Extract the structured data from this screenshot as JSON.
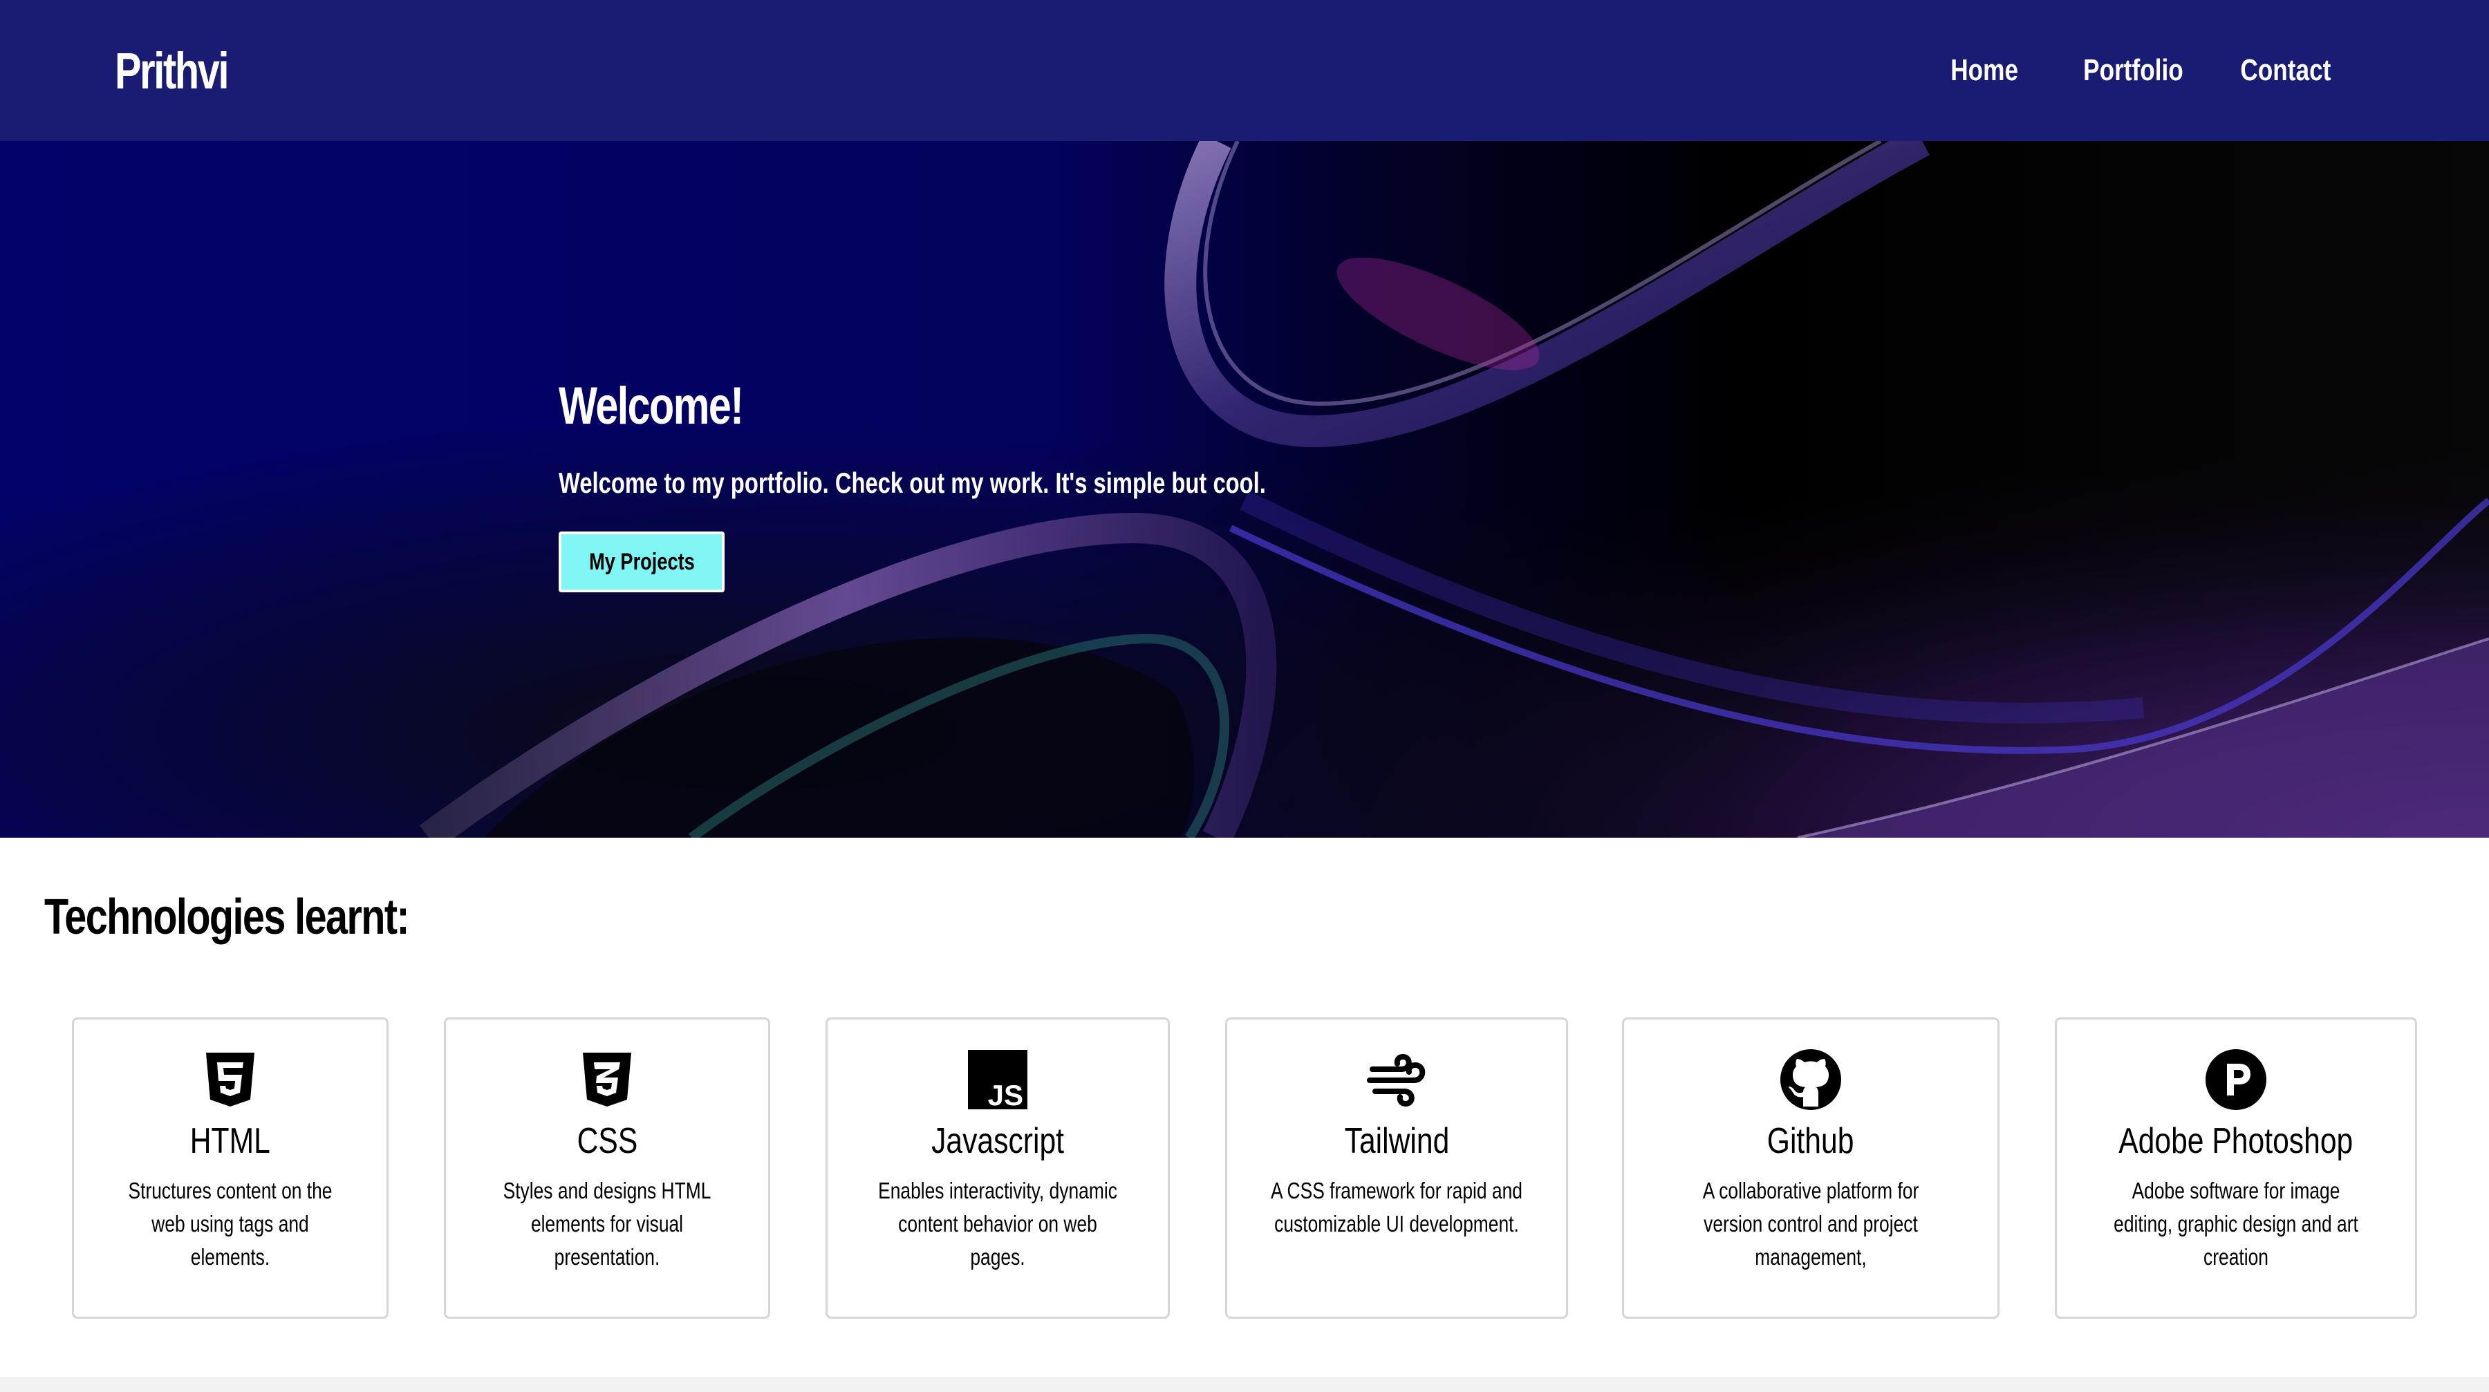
{
  "nav": {
    "brand": "Prithvi",
    "links": [
      "Home",
      "Portfolio",
      "Contact"
    ]
  },
  "hero": {
    "title": "Welcome!",
    "subtitle": "Welcome to my portfolio. Check out my work. It's simple but cool.",
    "button_label": "My Projects"
  },
  "tech": {
    "heading": "Technologies learnt:",
    "cards": [
      {
        "title": "HTML",
        "icon": "html5-icon",
        "desc": "Structures content on the web using tags and elements."
      },
      {
        "title": "CSS",
        "icon": "css3-icon",
        "desc": "Styles and designs HTML elements for visual presentation."
      },
      {
        "title": "Javascript",
        "icon": "javascript-icon",
        "desc": "Enables interactivity, dynamic content behavior on web pages."
      },
      {
        "title": "Tailwind",
        "icon": "wind-icon",
        "desc": "A CSS framework for rapid and customizable UI development."
      },
      {
        "title": "Github",
        "icon": "github-icon",
        "desc": "A collaborative platform for version control and project management,"
      },
      {
        "title": "Adobe Photoshop",
        "icon": "photoshop-p-icon",
        "desc": "Adobe software for image editing, graphic design and art creation"
      }
    ]
  },
  "colors": {
    "navbar": "#1a1b72",
    "hero_dark_blue": "#03026a",
    "button_cyan": "#7ff5f4"
  }
}
